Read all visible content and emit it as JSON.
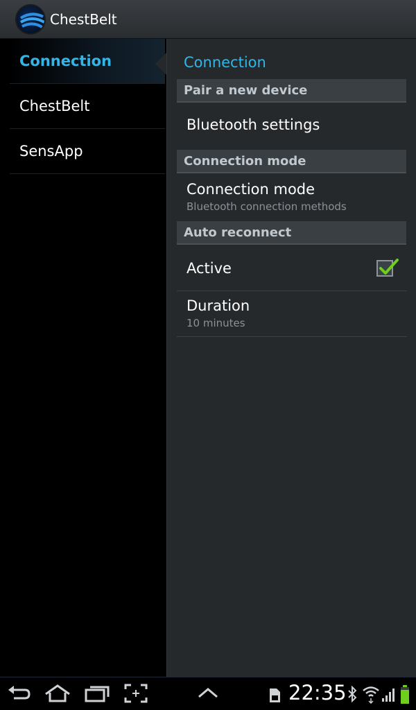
{
  "app": {
    "title": "ChestBelt",
    "icon": "chestbelt-logo-icon"
  },
  "headers": [
    {
      "label": "Connection",
      "selected": true
    },
    {
      "label": "ChestBelt",
      "selected": false
    },
    {
      "label": "SensApp",
      "selected": false
    }
  ],
  "detail": {
    "breadcrumb": "Connection",
    "categories": {
      "pair": "Pair a new device",
      "mode": "Connection mode",
      "auto": "Auto reconnect"
    },
    "prefs": {
      "bluetooth": {
        "title": "Bluetooth settings"
      },
      "connection_mode": {
        "title": "Connection mode",
        "summary": "Bluetooth connection methods"
      },
      "active": {
        "title": "Active",
        "checked": true
      },
      "duration": {
        "title": "Duration",
        "summary": "10 minutes"
      }
    }
  },
  "system_bar": {
    "clock": "22:35",
    "icons": [
      "back-icon",
      "home-icon",
      "recent-apps-icon",
      "screenshot-icon",
      "menu-up-icon",
      "sd-card-icon",
      "bluetooth-icon",
      "wifi-icon",
      "signal-icon",
      "battery-icon"
    ]
  },
  "colors": {
    "accent": "#33b5e5",
    "check": "#6fce1e",
    "pane": "#25292c"
  }
}
